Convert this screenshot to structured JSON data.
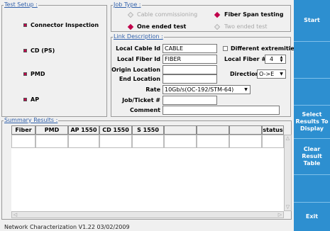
{
  "test_setup": {
    "title": "Test Setup :",
    "items": [
      "Connector Inspection",
      "CD (PS)",
      "PMD",
      "AP"
    ]
  },
  "job_type": {
    "title": "Job Type :",
    "cable_commissioning": "Cable commissioning",
    "fiber_span_testing": "Fiber Span testing",
    "one_ended": "One ended test",
    "two_ended": "Two ended test"
  },
  "link_description": {
    "title": "Link Description :",
    "local_cable_id_label": "Local Cable Id",
    "local_cable_id_value": "CABLE",
    "local_fiber_id_label": "Local Fiber Id",
    "local_fiber_id_value": "FIBER",
    "origin_location_label": "Origin Location",
    "origin_location_value": "",
    "end_location_label": "End Location",
    "end_location_value": "",
    "rate_label": "Rate",
    "rate_value": "10Gb/s(OC-192/STM-64)",
    "job_ticket_label": "Job/Ticket #",
    "job_ticket_value": "",
    "comment_label": "Comment",
    "comment_value": "",
    "different_extremities_label": "Different extremities",
    "local_fiber_num_label": "Local Fiber #",
    "local_fiber_num_value": "4",
    "direction_label": "Direction",
    "direction_value": "O->E"
  },
  "summary": {
    "title": "Summary Results :",
    "columns": [
      "Fiber #",
      "PMD",
      "AP 1550",
      "CD 1550",
      "S 1550",
      "",
      "",
      "status"
    ]
  },
  "sidebar": {
    "start": "Start",
    "select_results": [
      "Select",
      "Results To",
      "Display"
    ],
    "clear_results": [
      "Clear",
      "Result",
      "Table"
    ],
    "exit": "Exit"
  },
  "status_text": "Network Characterization V1.22 03/02/2009",
  "colors": {
    "accent": "#2d8fd0",
    "bullet": "#c0004a",
    "legend": "#2f5faa"
  }
}
